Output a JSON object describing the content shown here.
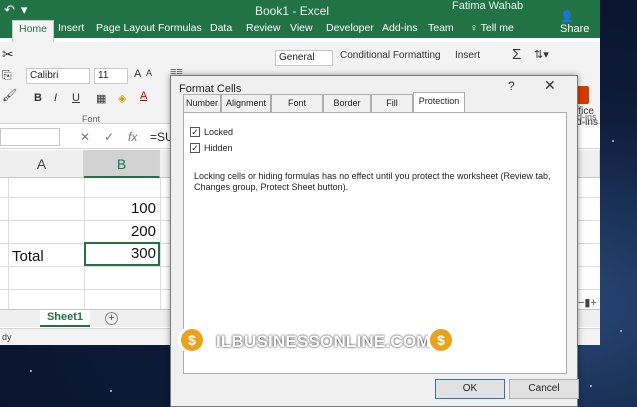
{
  "window": {
    "title": "Book1 - Excel",
    "user": "Fatima Wahab",
    "tell_me": "Tell me",
    "share": "Share"
  },
  "ribbon_tabs": [
    "Home",
    "Insert",
    "Page Layout",
    "Formulas",
    "Data",
    "Review",
    "View",
    "Developer",
    "Add-ins",
    "Team"
  ],
  "ribbon": {
    "font_name": "Calibri",
    "font_size": "11",
    "number_format": "General",
    "conditional_formatting": "Conditional Formatting",
    "insert": "Insert",
    "font_group": "Font",
    "add_ins_group": "Add-ins",
    "office_addins": "Office Add-ins",
    "bold": "B",
    "italic": "I",
    "underline": "U",
    "sum": "Σ"
  },
  "formula_bar": {
    "fx": "fx",
    "content": "=SU"
  },
  "grid": {
    "columns": [
      "A",
      "B"
    ],
    "cells": [
      {
        "ref": "B2",
        "value": "100"
      },
      {
        "ref": "B3",
        "value": "200"
      },
      {
        "ref": "A4",
        "value": "Total"
      },
      {
        "ref": "B4",
        "value": "300"
      }
    ]
  },
  "sheet_tab": "Sheet1",
  "status": {
    "ready": "dy"
  },
  "dialog": {
    "title": "Format Cells",
    "tabs": [
      "Number",
      "Alignment",
      "Font",
      "Border",
      "Fill",
      "Protection"
    ],
    "active_tab": "Protection",
    "locked_label": "Locked",
    "hidden_label": "Hidden",
    "locked_checked": true,
    "hidden_checked": true,
    "note": "Locking cells or hiding formulas has no effect until you protect the worksheet (Review tab, Changes group, Protect Sheet button).",
    "ok_label": "OK",
    "cancel_label": "Cancel",
    "help": "?",
    "close": "✕"
  },
  "watermark": {
    "text": "ILBUSINESSONLINE.COM",
    "coin_symbol": "$"
  },
  "colors": {
    "excel_green": "#217346",
    "desktop_blue": "#0c1a33",
    "coin": "#e8a21c"
  }
}
